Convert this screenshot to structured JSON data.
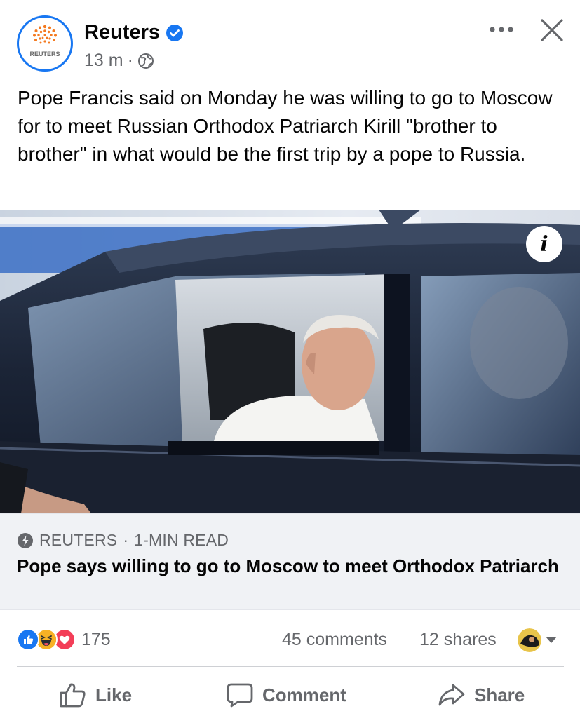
{
  "post": {
    "author": "Reuters",
    "avatar_text": "REUTERS",
    "time": "13 m",
    "separator": "·",
    "audience_icon": "globe-icon",
    "text": "Pope Francis said on Monday he was willing to go to Moscow for to meet Russian Orthodox Patriarch Kirill \"brother to brother\" in what would be the first trip by a pope to Russia."
  },
  "link": {
    "source": "REUTERS",
    "dot": "·",
    "read_time": "1-MIN READ",
    "title": "Pope says willing to go to Moscow to meet Orthodox Patriarch"
  },
  "stats": {
    "reactions_count": "175",
    "reaction_types": [
      "like-icon",
      "haha-icon",
      "love-icon"
    ],
    "comments": "45 comments",
    "shares": "12 shares"
  },
  "actions": {
    "like": "Like",
    "comment": "Comment",
    "share": "Share"
  },
  "colors": {
    "brand_blue": "#1877f2",
    "secondary_text": "#65676b",
    "link_card_bg": "#f0f2f5",
    "reuters_orange": "#f47a20",
    "love_red": "#f33e58",
    "haha_yellow": "#f7b125"
  }
}
